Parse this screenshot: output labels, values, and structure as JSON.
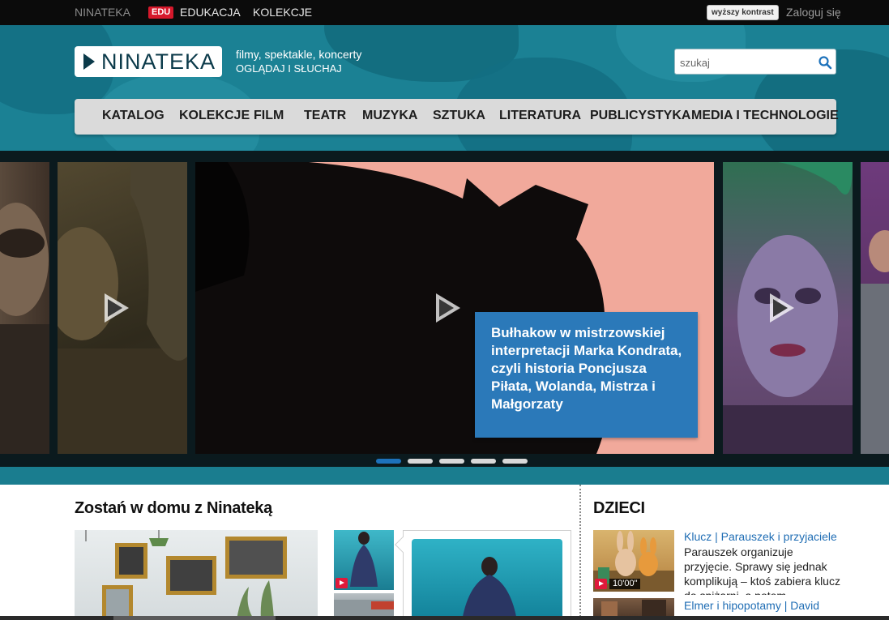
{
  "topbar": {
    "brand": "NINATEKA",
    "edu_badge": "EDU",
    "edu_label": "EDUKACJA",
    "kolekcje_label": "KOLEKCJE",
    "contrast_label": "wyższy kontrast",
    "login_label": "Zaloguj się"
  },
  "header": {
    "logo_text": "NINATEKA",
    "tagline_line1": "filmy, spektakle, koncerty",
    "tagline_line2": "OGLĄDAJ I SŁUCHAJ",
    "search_placeholder": "szukaj"
  },
  "nav": {
    "items": [
      "KATALOG",
      "KOLEKCJE",
      "FILM",
      "TEATR",
      "MUZYKA",
      "SZTUKA",
      "LITERATURA",
      "PUBLICYSTYKA",
      "MEDIA I TECHNOLOGIE"
    ]
  },
  "slider": {
    "caption": "Bułhakow w mistrzowskiej interpretacji Marka Kondrata, czyli historia Poncjusza Piłata, Wolanda, Mistrza i Małgorzaty",
    "dot_count": 5,
    "active_dot": 1
  },
  "main": {
    "section_title": "Zostań w domu z Ninateką"
  },
  "kids": {
    "title": "DZIECI",
    "item1_title": "Klucz | Parauszek i przyjaciele",
    "item1_desc": "Parauszek organizuje przyjęcie. Sprawy się jednak komplikują – ktoś zabiera klucz do spiżarni, a potem",
    "item1_duration": "10'00\"",
    "item2_title": "Elmer i hipopotamy | David"
  },
  "colors": {
    "header_teal": "#1b8194",
    "caption_blue": "#2b79b9",
    "active_dot": "#1d72bb",
    "edu_red": "#d6182b",
    "link_blue": "#1f6db4"
  }
}
